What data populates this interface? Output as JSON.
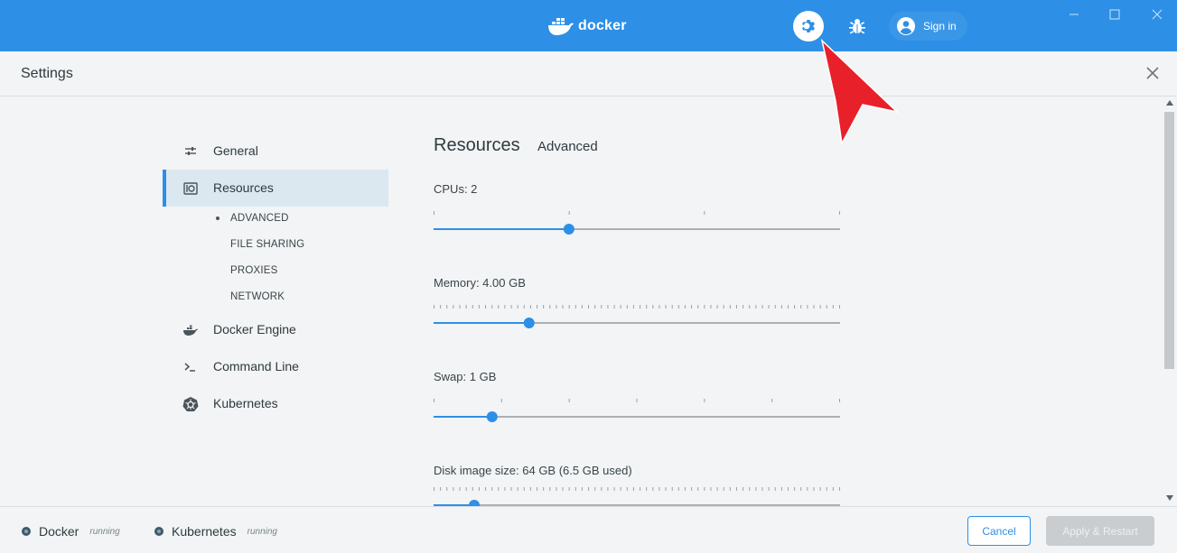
{
  "titlebar": {
    "brand": "docker",
    "sign_in_label": "Sign in",
    "color": "#2d8fe6"
  },
  "header": {
    "title": "Settings"
  },
  "sidebar": {
    "items": [
      {
        "label": "General",
        "icon": "sliders-icon"
      },
      {
        "label": "Resources",
        "icon": "resources-icon",
        "active": true
      },
      {
        "label": "Docker Engine",
        "icon": "whale-icon"
      },
      {
        "label": "Command Line",
        "icon": "terminal-icon"
      },
      {
        "label": "Kubernetes",
        "icon": "kubernetes-icon"
      }
    ],
    "sub_items": [
      {
        "label": "ADVANCED",
        "active": true
      },
      {
        "label": "FILE SHARING"
      },
      {
        "label": "PROXIES"
      },
      {
        "label": "NETWORK"
      }
    ]
  },
  "main": {
    "title": "Resources",
    "subtitle": "Advanced",
    "fields": [
      {
        "label": "CPUs: 2",
        "value_fraction": 0.333
      },
      {
        "label": "Memory: 4.00 GB",
        "value_fraction": 0.235
      },
      {
        "label": "Swap: 1 GB",
        "value_fraction": 0.144
      },
      {
        "label": "Disk image size: 64 GB (6.5 GB used)",
        "value_fraction": 0.1
      }
    ]
  },
  "footer": {
    "statuses": [
      {
        "name": "Docker",
        "state": "running"
      },
      {
        "name": "Kubernetes",
        "state": "running"
      }
    ],
    "cancel_label": "Cancel",
    "apply_label": "Apply & Restart"
  }
}
